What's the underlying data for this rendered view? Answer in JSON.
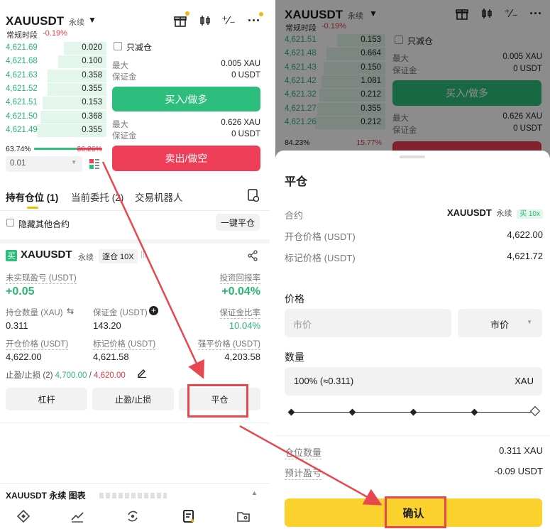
{
  "left": {
    "header": {
      "symbol": "XAUUSDT",
      "contract_type": "永续",
      "session": "常规时段",
      "change": "-0.19%"
    },
    "orderbook": {
      "rows": [
        {
          "price": "4,621.69",
          "qty": "0.020",
          "depth": 0.4
        },
        {
          "price": "4,621.68",
          "qty": "0.100",
          "depth": 0.45
        },
        {
          "price": "4,621.63",
          "qty": "0.358",
          "depth": 0.55
        },
        {
          "price": "4,621.52",
          "qty": "0.355",
          "depth": 0.55
        },
        {
          "price": "4,621.51",
          "qty": "0.153",
          "depth": 0.6
        },
        {
          "price": "4,621.50",
          "qty": "0.368",
          "depth": 0.62
        },
        {
          "price": "4,621.49",
          "qty": "0.355",
          "depth": 0.65
        }
      ],
      "buy_ratio": "63.74%",
      "sell_ratio": "36.26%",
      "buy_fraction": 0.6374,
      "precision": "0.01"
    },
    "order_form": {
      "reduce_only": "只减仓",
      "max_label": "最大",
      "margin_label": "保证金",
      "buy_max": "0.005 XAU",
      "buy_margin": "0 USDT",
      "buy_button": "买入/做多",
      "sell_max": "0.626 XAU",
      "sell_margin": "0 USDT",
      "sell_button": "卖出/做空"
    },
    "tabs": [
      "持有仓位 (1)",
      "当前委托 (2)",
      "交易机器人"
    ],
    "hide_other": "隐藏其他合约",
    "close_all": "一键平仓",
    "position": {
      "side_badge": "买",
      "symbol": "XAUUSDT",
      "contract_type": "永续",
      "margin_mode": "逐仓 10X",
      "unrealized_label": "未实现盈亏 (USDT)",
      "unrealized_value": "+0.05",
      "roi_label": "投资回报率",
      "roi_value": "+0.04%",
      "size_label": "持仓数量 (XAU)",
      "size_value": "0.311",
      "margin_label": "保证金 (USDT)",
      "margin_value": "143.20",
      "margin_ratio_label": "保证金比率",
      "margin_ratio_value": "10.04%",
      "entry_label": "开仓价格 (USDT)",
      "entry_value": "4,622.00",
      "mark_label": "标记价格 (USDT)",
      "mark_value": "4,621.58",
      "liq_label": "强平价格 (USDT)",
      "liq_value": "4,203.58",
      "tpsl_label": "止盈/止损 (2)",
      "tp_value": "4,700.00",
      "sl_value": "4,620.00",
      "tpsl_sep": "/"
    },
    "action_buttons": [
      "杠杆",
      "止盈/止损",
      "平仓"
    ],
    "chart_bar": {
      "title": "XAUUSDT 永续 图表"
    }
  },
  "right": {
    "header": {
      "symbol": "XAUUSDT",
      "contract_type": "永续",
      "session": "常规时段",
      "change": "-0.19%"
    },
    "orderbook": {
      "rows": [
        {
          "price": "4,621.51",
          "qty": "0.153",
          "depth": 0.45
        },
        {
          "price": "4,621.48",
          "qty": "0.664",
          "depth": 0.55
        },
        {
          "price": "4,621.43",
          "qty": "0.150",
          "depth": 0.58
        },
        {
          "price": "4,621.42",
          "qty": "1.081",
          "depth": 0.6
        },
        {
          "price": "4,621.32",
          "qty": "0.212",
          "depth": 0.62
        },
        {
          "price": "4,621.27",
          "qty": "0.355",
          "depth": 0.64
        },
        {
          "price": "4,621.26",
          "qty": "0.212",
          "depth": 0.66
        }
      ],
      "buy_ratio": "84.23%",
      "sell_ratio": "15.77%"
    },
    "order_form": {
      "reduce_only": "只减仓",
      "max_label": "最大",
      "margin_label": "保证金",
      "buy_max": "0.005 XAU",
      "buy_margin": "0 USDT",
      "buy_button": "买入/做多",
      "sell_max": "0.626 XAU",
      "sell_margin": "0 USDT"
    },
    "sheet": {
      "title": "平仓",
      "contract_label": "合约",
      "contract_symbol": "XAUUSDT",
      "contract_type": "永续",
      "contract_badge": "买 10x",
      "entry_label": "开仓价格 (USDT)",
      "entry_value": "4,622.00",
      "mark_label": "标记价格 (USDT)",
      "mark_value": "4,621.72",
      "price_label": "价格",
      "price_placeholder": "市价",
      "price_type": "市价",
      "qty_label": "数量",
      "qty_value": "100% (≈0.311)",
      "qty_unit": "XAU",
      "slider_percent": 100,
      "pos_label": "仓位数量",
      "pos_value": "0.311 XAU",
      "pnl_label": "预计盈亏",
      "pnl_value": "-0.09 USDT",
      "confirm": "确认"
    }
  },
  "colors": {
    "green": "#2dbd7c",
    "red": "#ee3d56",
    "confirm": "#fbd12e",
    "annotation": "#e8474f"
  },
  "nav_icons": [
    "home-icon",
    "chart-icon",
    "trade-icon",
    "orders-icon",
    "assets-icon"
  ]
}
